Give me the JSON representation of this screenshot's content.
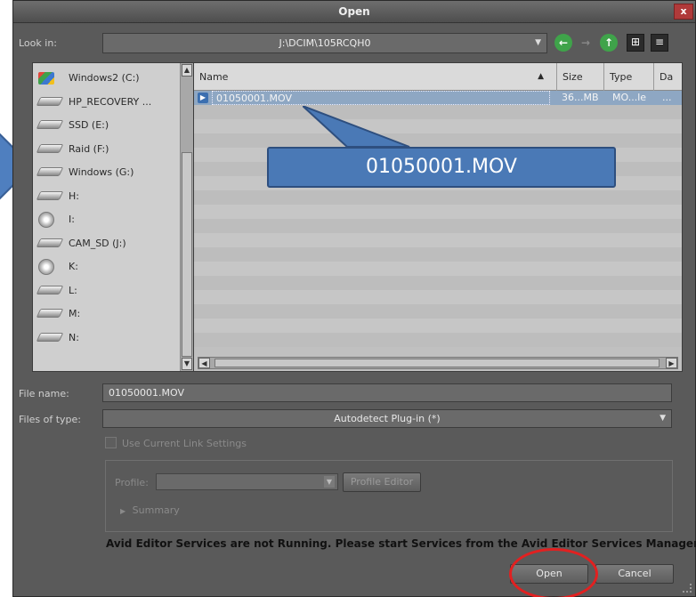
{
  "window": {
    "title": "Open",
    "close_label": "x"
  },
  "look_in": {
    "label": "Look in:",
    "value": "J:\\DCIM\\105RCQH0"
  },
  "toolbar": {
    "back_glyph": "←",
    "forward_glyph": "→",
    "up_glyph": "↑",
    "icons_view_glyph": "⊞",
    "list_view_glyph": "≡"
  },
  "drives": [
    {
      "label": "Windows2 (C:)",
      "icon": "windows-drive-icon"
    },
    {
      "label": "HP_RECOVERY ...",
      "icon": "drive-icon"
    },
    {
      "label": "SSD (E:)",
      "icon": "drive-icon"
    },
    {
      "label": "Raid (F:)",
      "icon": "drive-icon"
    },
    {
      "label": "Windows  (G:)",
      "icon": "drive-icon"
    },
    {
      "label": "H:",
      "icon": "drive-icon"
    },
    {
      "label": "I:",
      "icon": "dvd-drive-icon"
    },
    {
      "label": "CAM_SD (J:)",
      "icon": "drive-icon"
    },
    {
      "label": "K:",
      "icon": "dvd-drive-icon"
    },
    {
      "label": "L:",
      "icon": "drive-icon"
    },
    {
      "label": "M:",
      "icon": "drive-icon"
    },
    {
      "label": "N:",
      "icon": "drive-icon"
    }
  ],
  "file_list": {
    "columns": [
      "Name",
      "Size",
      "Type",
      "Da"
    ],
    "sort_indicator": "▲",
    "rows": [
      {
        "name": "01050001.MOV",
        "size": "36...MB",
        "type": "MO...le",
        "date": "..."
      }
    ]
  },
  "callout": {
    "text": "01050001.MOV"
  },
  "file_name": {
    "label": "File name:",
    "value": "01050001.MOV"
  },
  "files_of_type": {
    "label": "Files of type:",
    "value": "Autodetect Plug-in (*)"
  },
  "link_settings": {
    "label": "Use Current Link Settings"
  },
  "profile": {
    "label": "Profile:",
    "editor_button": "Profile Editor"
  },
  "summary": {
    "label": "Summary",
    "glyph": "▶"
  },
  "warning": "Avid Editor Services are not Running. Please start Services from the Avid Editor Services Manager",
  "buttons": {
    "open": "Open",
    "cancel": "Cancel"
  },
  "colors": {
    "dialog_bg": "#5a5a5a",
    "selection": "#8ea7c3",
    "callout": "#4a79b6",
    "highlight_circle": "#e22020"
  }
}
